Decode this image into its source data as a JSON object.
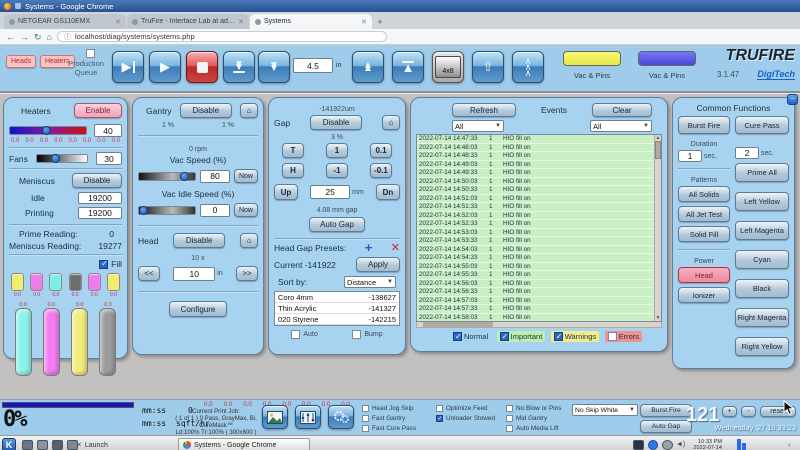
{
  "browser": {
    "window_title": "Systems - Google Chrome",
    "tabs": [
      {
        "label": "NETGEAR GS110EMX"
      },
      {
        "label": "TruFire - Interface Lab at admin"
      },
      {
        "label": "Systems"
      }
    ],
    "url": "localhost/diag/systems/systems.php"
  },
  "toolbar": {
    "heads": "Heads",
    "heaters": "Heaters",
    "production_queue": "Production Queue",
    "feed_value": "4.5",
    "feed_unit": "in",
    "bed_button": "4x8",
    "vac_pins_yellow": "Vac & Pins",
    "vac_pins_blue": "Vac & Pins",
    "brand": "TRUFIRE",
    "version": "3.1.47",
    "vendor": "DigiTech"
  },
  "heaters": {
    "title": "Heaters",
    "enable": "Enable",
    "setpoint": "40",
    "zones": [
      "0.0",
      "0.0",
      "0.0",
      "0.0",
      "0.0",
      "0.0",
      "0.0",
      "0.0"
    ],
    "fans_label": "Fans",
    "fans_value": "30",
    "meniscus_label": "Meniscus",
    "meniscus_btn": "Disable",
    "idle_label": "Idle",
    "idle_value": "19200",
    "printing_label": "Printing",
    "printing_value": "19200",
    "prime_label": "Prime Reading:",
    "prime_value": "0",
    "mreading_label": "Meniscus Reading:",
    "mreading_value": "19277",
    "fill_label": "Fill",
    "fill_checked": true,
    "swatches": [
      {
        "color": "#f0ec6e",
        "label": "0.0"
      },
      {
        "color": "#ec7cec",
        "label": "0.0"
      },
      {
        "color": "#7ceee8",
        "label": "0.0"
      },
      {
        "color": "#6e6e6e",
        "label": "0.0"
      },
      {
        "color": "#ec7cec",
        "label": "0.0"
      },
      {
        "color": "#f0ec6e",
        "label": "0.0"
      }
    ],
    "tanks": [
      {
        "color": "#8cf2ea",
        "label": "0.0"
      },
      {
        "color": "#f27cf2",
        "label": "0.0"
      },
      {
        "color": "#f0ec7c",
        "label": "0.0"
      },
      {
        "color": "#9c9c9c",
        "label": "0.0"
      }
    ]
  },
  "gantry": {
    "title": "Gantry",
    "disable": "Disable",
    "pct_left": "1 %",
    "pct_right": "1 %",
    "rpm": "0 rpm",
    "vac_speed_label": "Vac Speed (%)",
    "vac_speed_value": "80",
    "now": "Now",
    "vac_idle_label": "Vac Idle Speed (%)",
    "vac_idle_value": "0",
    "now2": "Now",
    "head_label": "Head",
    "head_disable": "Disable",
    "step_label": "10 x",
    "jog_back": "<<",
    "jog_value": "10",
    "jog_unit": "in",
    "jog_fwd": ">>",
    "configure": "Configure"
  },
  "gap": {
    "position": "-141922um",
    "title": "Gap",
    "disable": "Disable",
    "pct": "3 %",
    "t": "T",
    "plus1": "1",
    "plus01": "0.1",
    "h": "H",
    "minus1": "-1",
    "minus01": "-0.1",
    "up": "Up",
    "value": "25",
    "unit": "mm",
    "dn": "Dn",
    "gap_info": "4.08 mm gap",
    "auto_gap": "Auto Gap"
  },
  "presets": {
    "title": "Head Gap Presets:",
    "add": "+",
    "delete": "✕",
    "current": "Current -141922",
    "apply": "Apply",
    "sort_label": "Sort by:",
    "sort_value": "Distance",
    "rows": [
      {
        "name": "Coro 4mm",
        "value": "-138627"
      },
      {
        "name": "Thin Acrylic",
        "value": "-141327"
      },
      {
        "name": "020 Styrene",
        "value": "-142215"
      }
    ],
    "auto": "Auto",
    "bump": "Bump"
  },
  "events": {
    "refresh": "Refresh",
    "title": "Events",
    "clear": "Clear",
    "filter_left": "All",
    "filter_right": "All",
    "rows": [
      {
        "time": "2022-07-14 14:47:33",
        "code": "1",
        "msg": "HIO fill on"
      },
      {
        "time": "2022-07-14 14:48:03",
        "code": "1",
        "msg": "HIO fill on"
      },
      {
        "time": "2022-07-14 14:48:33",
        "code": "1",
        "msg": "HIO fill on"
      },
      {
        "time": "2022-07-14 14:49:03",
        "code": "1",
        "msg": "HIO fill on"
      },
      {
        "time": "2022-07-14 14:49:33",
        "code": "1",
        "msg": "HIO fill on"
      },
      {
        "time": "2022-07-14 14:50:03",
        "code": "1",
        "msg": "HIO fill on"
      },
      {
        "time": "2022-07-14 14:50:33",
        "code": "1",
        "msg": "HIO fill on"
      },
      {
        "time": "2022-07-14 14:51:03",
        "code": "1",
        "msg": "HIO fill on"
      },
      {
        "time": "2022-07-14 14:51:33",
        "code": "1",
        "msg": "HIO fill on"
      },
      {
        "time": "2022-07-14 14:52:03",
        "code": "1",
        "msg": "HIO fill on"
      },
      {
        "time": "2022-07-14 14:52:33",
        "code": "1",
        "msg": "HIO fill on"
      },
      {
        "time": "2022-07-14 14:53:03",
        "code": "1",
        "msg": "HIO fill on"
      },
      {
        "time": "2022-07-14 14:53:33",
        "code": "1",
        "msg": "HIO fill on"
      },
      {
        "time": "2022-07-14 14:54:03",
        "code": "1",
        "msg": "HIO fill on"
      },
      {
        "time": "2022-07-14 14:54:33",
        "code": "1",
        "msg": "HIO fill on"
      },
      {
        "time": "2022-07-14 14:55:03",
        "code": "1",
        "msg": "HIO fill on"
      },
      {
        "time": "2022-07-14 14:55:33",
        "code": "1",
        "msg": "HIO fill on"
      },
      {
        "time": "2022-07-14 14:56:03",
        "code": "1",
        "msg": "HIO fill on"
      },
      {
        "time": "2022-07-14 14:56:33",
        "code": "1",
        "msg": "HIO fill on"
      },
      {
        "time": "2022-07-14 14:57:03",
        "code": "1",
        "msg": "HIO fill on"
      },
      {
        "time": "2022-07-14 14:57:33",
        "code": "1",
        "msg": "HIO fill on"
      },
      {
        "time": "2022-07-14 14:58:03",
        "code": "1",
        "msg": "HIO fill on"
      }
    ],
    "filters": [
      {
        "label": "Normal",
        "checked": true,
        "bg": "transparent"
      },
      {
        "label": "Important",
        "checked": true,
        "bg": "#b9f0ae"
      },
      {
        "label": "Warnings",
        "checked": true,
        "bg": "#f0ee8e"
      },
      {
        "label": "Errors",
        "checked": false,
        "bg": "#f09090"
      }
    ]
  },
  "common": {
    "title": "Common Functions",
    "burst_fire": "Burst Fire",
    "cure_pass": "Cure Pass",
    "duration_label": "Duration",
    "duration1": "1",
    "sec1": "sec.",
    "duration2": "2",
    "sec2": "sec.",
    "patterns_label": "Patterns",
    "all_solids": "All Solids",
    "all_jet_test": "All Jet Test",
    "solid_fill": "Solid Fill",
    "power_label": "Power",
    "head": "Head",
    "ionizer": "Ionizer",
    "prime_all": "Prime All",
    "left_yellow": "Left Yellow",
    "left_magenta": "Left Magenta",
    "cyan": "Cyan",
    "black": "Black",
    "right_magenta": "Right Magenta",
    "right_yellow": "Right Yellow"
  },
  "status": {
    "progress": "0%",
    "time1": "mm:ss",
    "time2": "mm:ss",
    "rate_value": "0",
    "rate_unit": "sqft/hr",
    "zones": [
      "0.0",
      "0.0",
      "0.0",
      "0.0",
      "0.0",
      "0.0",
      "0.0",
      "0.0"
    ],
    "job_label": "Current Print Job:",
    "job_line1": "( 1 of 1 ) 0 Pass, GrayMax, Bi, CureMask™",
    "job_line2": "Ld:100% Tr:100%  ( 300x600 )",
    "checks_col1": [
      {
        "label": "Head Jog Skip",
        "checked": false
      },
      {
        "label": "Fast Gantry",
        "checked": false
      },
      {
        "label": "Fast Cure Pass",
        "checked": false
      }
    ],
    "checks_col2": [
      {
        "label": "Optimize Feed",
        "checked": false
      },
      {
        "label": "Unloader Stowed",
        "checked": true
      }
    ],
    "checks_col3": [
      {
        "label": "No Blow or Pins",
        "checked": false
      },
      {
        "label": "Mid Gantry",
        "checked": false
      },
      {
        "label": "Auto Media Lift",
        "checked": false
      }
    ],
    "skip_dropdown": "No Skip White",
    "burst_fire": "Burst Fire",
    "auto_gap": "Auto Gap",
    "counter": "121",
    "plus": "+",
    "minus": "-",
    "reset": "reset",
    "datetime": "Wednesday, 27 10:33:23"
  },
  "taskbar": {
    "launch": "Launch",
    "task": "Systems - Google Chrome",
    "clock_line1": "10:33 PM",
    "clock_line2": "2022-07-14"
  }
}
